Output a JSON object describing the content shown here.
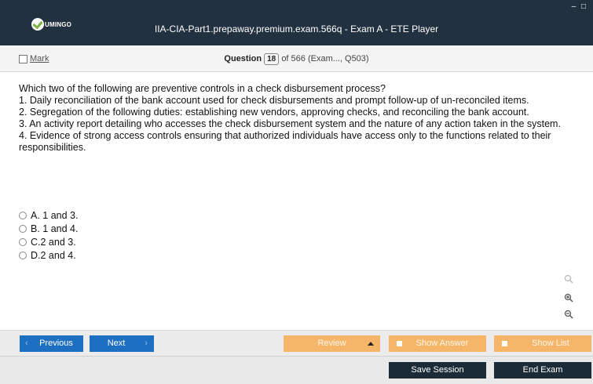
{
  "window": {
    "title": "IIA-CIA-Part1.prepaway.premium.exam.566q - Exam A - ETE Player",
    "logo_text": "UMINGO",
    "controls": "– □"
  },
  "question_bar": {
    "mark_label": "Mark",
    "question_word": "Question",
    "question_number": "18",
    "of_text": "of 566 (Exam..., Q503)"
  },
  "question": {
    "lines": [
      "Which two of the following are preventive controls in a check disbursement process?",
      "1. Daily reconciliation of the bank account used for check disbursements and prompt follow-up of un-reconciled items.",
      "2. Segregation of the following duties: establishing new vendors, approving checks, and reconciling the bank account.",
      "3. An activity report detailing who accesses the check disbursement system and the nature of any action taken in the system.",
      "4. Evidence of strong access controls ensuring that authorized individuals have access only to the functions related to their responsibilities."
    ]
  },
  "options": [
    {
      "letter": "A.",
      "text": "1 and 3."
    },
    {
      "letter": "B.",
      "text": "1 and 4."
    },
    {
      "letter": "C.",
      "text": "2 and 3."
    },
    {
      "letter": "D.",
      "text": "2 and 4."
    }
  ],
  "zoom": {
    "search_icon": "magnifier-icon",
    "zoom_in_icon": "zoom-in-icon",
    "zoom_out_icon": "zoom-out-icon"
  },
  "toolbar": {
    "previous_label": "Previous",
    "next_label": "Next",
    "review_label": "Review",
    "show_answer_label": "Show Answer",
    "show_list_label": "Show List",
    "accent_blue": "#1d6fc2",
    "accent_orange": "#f5b66a"
  },
  "footer": {
    "save_session_label": "Save Session",
    "end_exam_label": "End Exam",
    "button_color": "#1b2b38"
  }
}
